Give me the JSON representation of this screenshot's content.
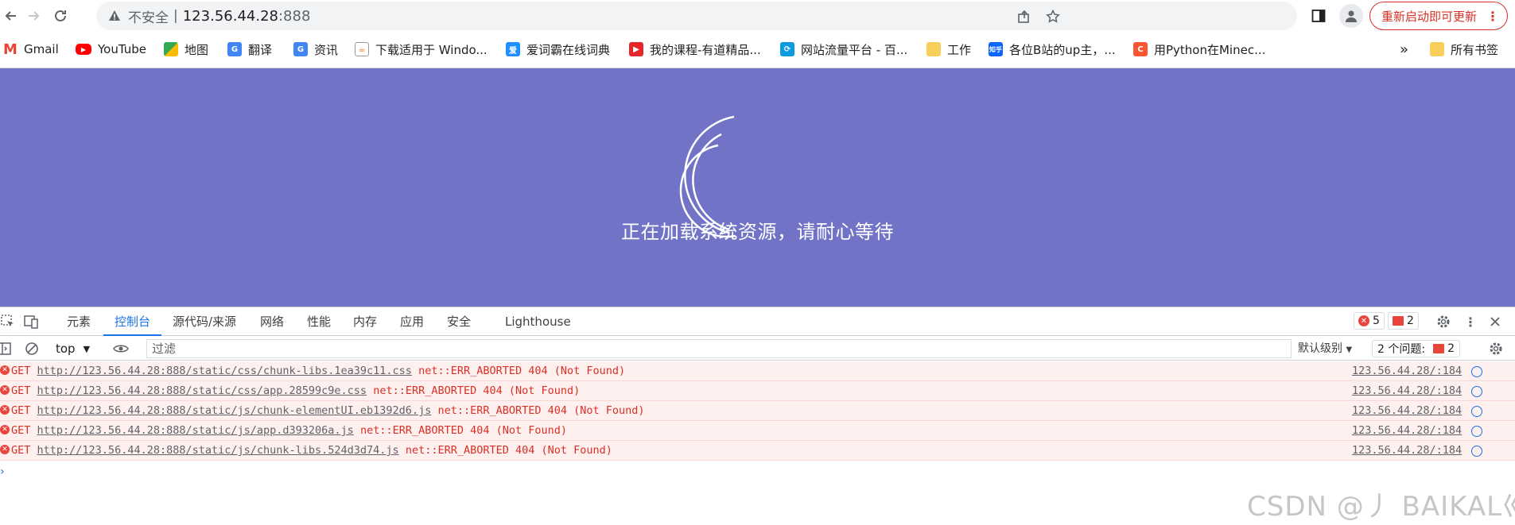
{
  "omnibox": {
    "security_label": "不安全",
    "separator": "|",
    "host": "123.56.44.28",
    "port": ":888"
  },
  "update_button": {
    "label": "重新启动即可更新"
  },
  "bookmarks": [
    {
      "label": "Gmail",
      "icon": "gmail-icon",
      "color": "#ea4335"
    },
    {
      "label": "YouTube",
      "icon": "youtube-icon",
      "color": "#ff0000"
    },
    {
      "label": "地图",
      "icon": "maps-icon",
      "color": "#34a853"
    },
    {
      "label": "翻译",
      "icon": "translate-icon",
      "color": "#4285f4"
    },
    {
      "label": "资讯",
      "icon": "news-icon",
      "color": "#4285f4"
    },
    {
      "label": "下载适用于 Windo...",
      "icon": "java-icon",
      "color": "#e76f00"
    },
    {
      "label": "爱词霸在线词典",
      "icon": "iciba-icon",
      "color": "#1e90ff"
    },
    {
      "label": "我的课程-有道精品...",
      "icon": "youdao-icon",
      "color": "#e5262b"
    },
    {
      "label": "网站流量平台 - 百...",
      "icon": "baidu-stat-icon",
      "color": "#0a9be0"
    },
    {
      "label": "工作",
      "icon": "folder-icon",
      "color": "#f9cf5b"
    },
    {
      "label": "各位B站的up主，...",
      "icon": "zhihu-icon",
      "color": "#0a66ff"
    },
    {
      "label": "用Python在Minec...",
      "icon": "csdn-icon",
      "color": "#fc5531"
    }
  ],
  "bookmarks_overflow": "»",
  "all_bookmarks": "所有书签",
  "page": {
    "loading_text": "正在加载系统资源，请耐心等待",
    "background": "#7173c6"
  },
  "devtools": {
    "tabs": [
      "元素",
      "控制台",
      "源代码/来源",
      "网络",
      "性能",
      "内存",
      "应用",
      "安全",
      "Lighthouse"
    ],
    "active_tab": "控制台",
    "error_count": "5",
    "issue_count": "2",
    "context": "top",
    "filter_placeholder": "过滤",
    "level": "默认级别",
    "issues_label": "2 个问题:",
    "issues_badge": "2",
    "logs": [
      {
        "method": "GET",
        "url": "http://123.56.44.28:888/static/css/chunk-libs.1ea39c11.css",
        "error": "net::ERR_ABORTED 404 (Not Found)",
        "source": "123.56.44.28/:184"
      },
      {
        "method": "GET",
        "url": "http://123.56.44.28:888/static/css/app.28599c9e.css",
        "error": "net::ERR_ABORTED 404 (Not Found)",
        "source": "123.56.44.28/:184"
      },
      {
        "method": "GET",
        "url": "http://123.56.44.28:888/static/js/chunk-elementUI.eb1392d6.js",
        "error": "net::ERR_ABORTED 404 (Not Found)",
        "source": "123.56.44.28/:184"
      },
      {
        "method": "GET",
        "url": "http://123.56.44.28:888/static/js/app.d393206a.js",
        "error": "net::ERR_ABORTED 404 (Not Found)",
        "source": "123.56.44.28/:184"
      },
      {
        "method": "GET",
        "url": "http://123.56.44.28:888/static/js/chunk-libs.524d3d74.js",
        "error": "net::ERR_ABORTED 404 (Not Found)",
        "source": "123.56.44.28/:184"
      }
    ],
    "prompt": "›"
  },
  "watermark": "CSDN @丿 BAIKAL巛"
}
